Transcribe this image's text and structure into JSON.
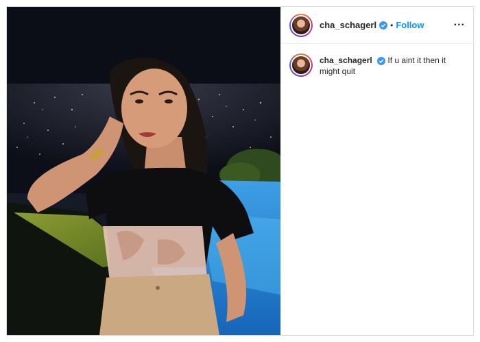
{
  "post": {
    "username": "cha_schagerl",
    "follow_label": "Follow",
    "separator": "•",
    "more_label": "...",
    "caption_username": "cha_schagerl",
    "caption_text": "If u aint it then it might quit"
  },
  "colors": {
    "follow": "#0095f6",
    "verified": "#3897f0",
    "border": "#dbdbdb"
  },
  "icons": {
    "verified": "verified-badge-icon",
    "more": "more-options-icon"
  }
}
